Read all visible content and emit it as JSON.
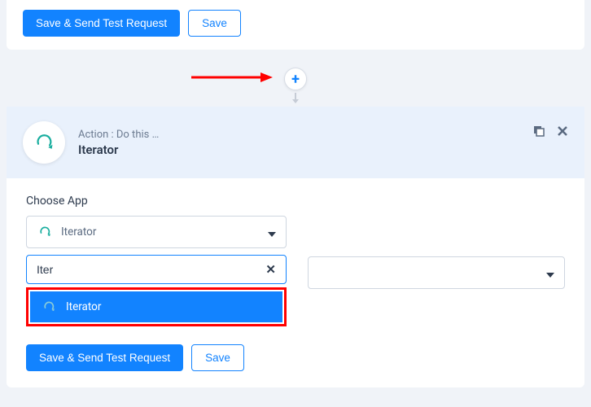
{
  "top_card": {
    "save_send_label": "Save & Send Test Request",
    "save_label": "Save"
  },
  "step": {
    "label": "Action : Do this …",
    "title": "Iterator"
  },
  "choose_app": {
    "label": "Choose App",
    "selected": "Iterator",
    "search_value": "Iter",
    "dropdown_item": "Iterator"
  },
  "bottom": {
    "save_send_label": "Save & Send Test Request",
    "save_label": "Save"
  }
}
